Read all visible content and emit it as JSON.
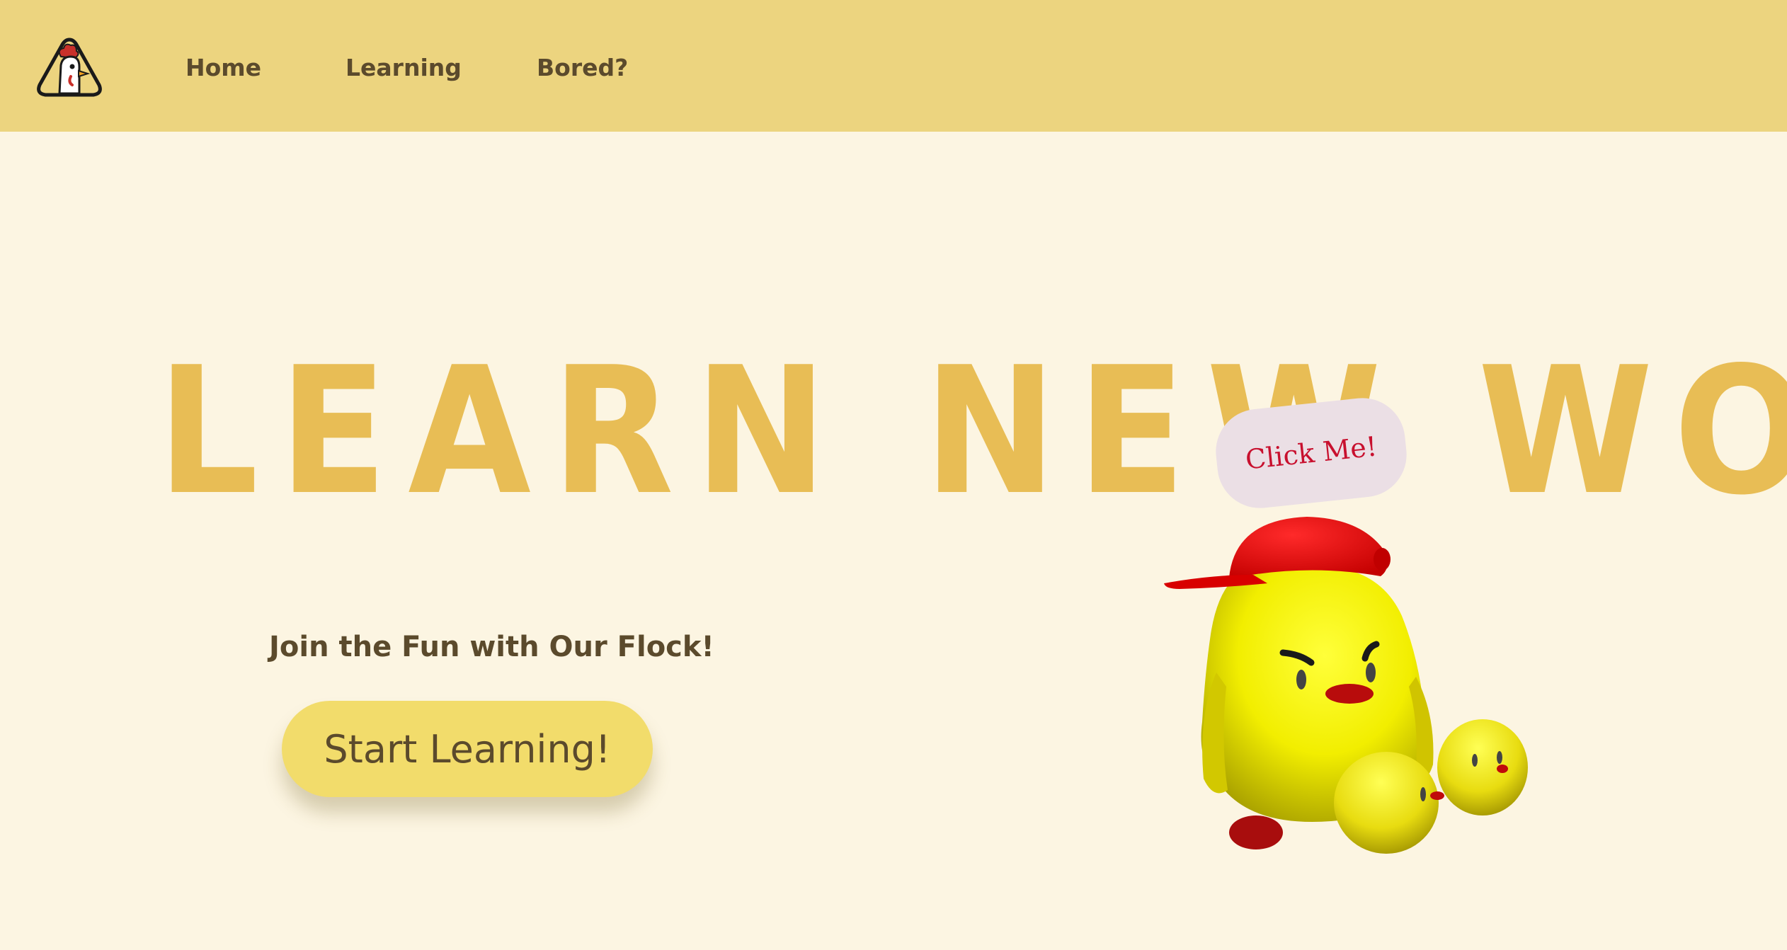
{
  "header": {
    "logo_icon": "chicken-logo-icon",
    "nav": [
      {
        "label": "Home"
      },
      {
        "label": "Learning"
      },
      {
        "label": "Bored?"
      }
    ]
  },
  "hero": {
    "title": "LEARN NEW WORDS",
    "tagline": "Join the Fun with Our Flock!",
    "cta_label": "Start Learning!",
    "bubble_label": "Click Me!"
  },
  "colors": {
    "header_bg": "#ecd47f",
    "page_bg": "#fcf5e2",
    "title": "#e8bd55",
    "text": "#5b4a2c",
    "cta_bg": "#f2dc6b",
    "bubble_bg": "#ebdfe5",
    "bubble_text": "#c8102e"
  }
}
